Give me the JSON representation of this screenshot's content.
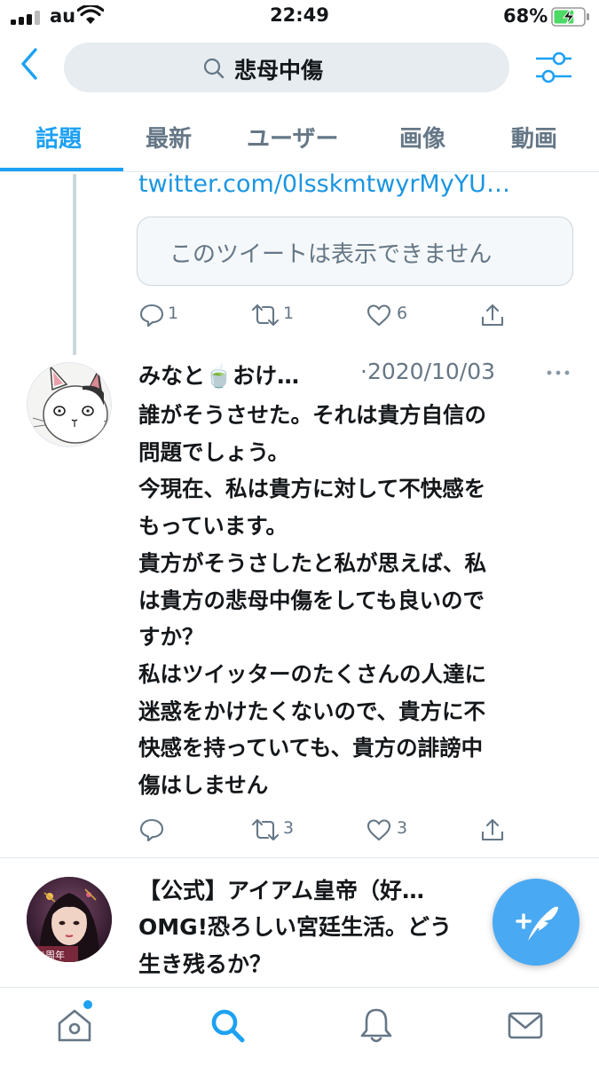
{
  "status_bar": {
    "carrier": "au",
    "time": "22:49",
    "battery": "68%",
    "battery_level": 0.68
  },
  "search": {
    "query": "悲母中傷",
    "back_icon": "chevron-left-icon",
    "filter_icon": "sliders-icon"
  },
  "tabs": [
    {
      "label": "話題",
      "active": true
    },
    {
      "label": "最新",
      "active": false
    },
    {
      "label": "ユーザー",
      "active": false
    },
    {
      "label": "画像",
      "active": false
    },
    {
      "label": "動画",
      "active": false
    }
  ],
  "tweet_prev": {
    "link": "twitter.com/0lsskmtwyrMyYU…",
    "quote_unavailable": "このツイートは表示できません",
    "reply_count": "1",
    "retweet_count": "1",
    "like_count": "6"
  },
  "tweet_main": {
    "name": "みなと🍵おけ…",
    "date": "·2020/10/03",
    "body_lines": [
      "誰がそうさせた。それは貴方自信の",
      "問題でしょう。",
      "今現在、私は貴方に対して不快感を",
      "もっています。",
      "貴方がそうさしたと私が思えば、私",
      "は貴方の悲母中傷をしても良いので",
      "すか？",
      "私はツイッターのたくさんの人達に",
      "迷惑をかけたくないので、貴方に不",
      "快感を持っていても、貴方の誹謗中",
      "傷はしません"
    ],
    "reply_count": "",
    "retweet_count": "3",
    "like_count": "3"
  },
  "tweet_promo": {
    "name": "【公式】アイアム皇帝（好…",
    "body_lines": [
      "OMG!恐ろしい宮廷生活。どう",
      "生き残るか？"
    ],
    "avatar_text": "二周年"
  },
  "bottom_nav": [
    "home-icon",
    "search-icon",
    "bell-icon",
    "mail-icon"
  ],
  "colors": {
    "accent": "#1da1f2",
    "link": "#1b95e0",
    "secondary_text": "#657786",
    "search_bg": "#e6ecf0"
  }
}
